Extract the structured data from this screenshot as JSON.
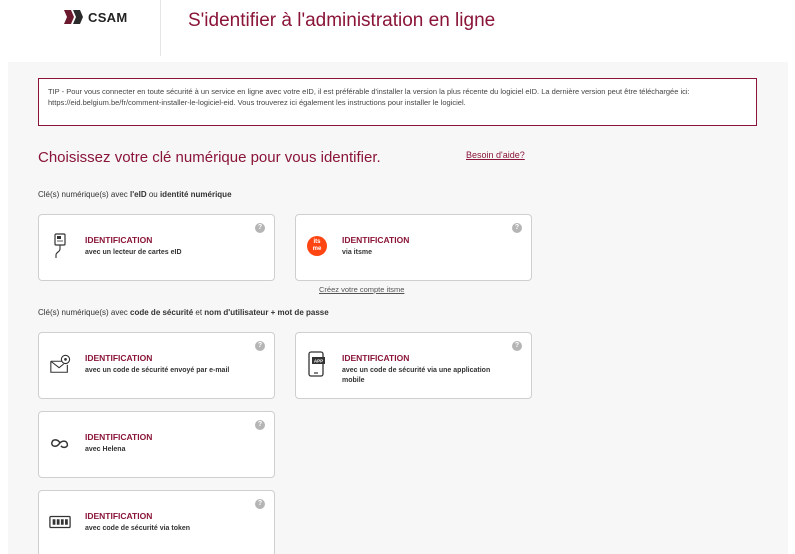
{
  "header": {
    "logo_text": "CSAM",
    "title": "S'identifier à l'administration en ligne"
  },
  "tip": {
    "text": "TIP - Pour vous connecter en toute sécurité à un service en ligne avec votre eID, il est préférable d'installer la version la plus récente du logiciel eID. La dernière version peut être téléchargée ici: https://eid.belgium.be/fr/comment-installer-le-logiciel-eid. Vous trouverez ici également les instructions pour installer le logiciel."
  },
  "main": {
    "choose_title": "Choisissez votre clé numérique pour vous identifier.",
    "help_link": "Besoin d'aide?",
    "section1": {
      "prefix": "Clé(s) numérique(s) avec ",
      "bold1": "l'eID",
      "mid": " ou ",
      "bold2": "identité numérique"
    },
    "section2": {
      "prefix": "Clé(s) numérique(s) avec ",
      "bold1": "code de sécurité",
      "mid": " et ",
      "bold2": "nom d'utilisateur + mot de passe"
    },
    "create_itsme_link": "Créez votre compte itsme",
    "help_icon_glyph": "?"
  },
  "cards": [
    {
      "icon": "card-reader-icon",
      "title": "IDENTIFICATION",
      "sub": "avec un lecteur de cartes eID"
    },
    {
      "icon": "itsme-icon",
      "icon_text_1": "its",
      "icon_text_2": "me",
      "title": "IDENTIFICATION",
      "sub": "via itsme"
    },
    {
      "icon": "email-icon",
      "title": "IDENTIFICATION",
      "sub": "avec un code de sécurité envoyé par e-mail"
    },
    {
      "icon": "mobile-app-icon",
      "icon_text": "APP",
      "title": "IDENTIFICATION",
      "sub": "avec un code de sécurité via une application mobile"
    },
    {
      "icon": "helena-icon",
      "title": "IDENTIFICATION",
      "sub": "avec Helena"
    },
    {
      "icon": "token-icon",
      "title": "IDENTIFICATION",
      "sub": "avec code de sécurité via token"
    }
  ],
  "colors": {
    "accent": "#8a1538",
    "itsme": "#ff4612",
    "card_border": "#cfcfcf"
  }
}
